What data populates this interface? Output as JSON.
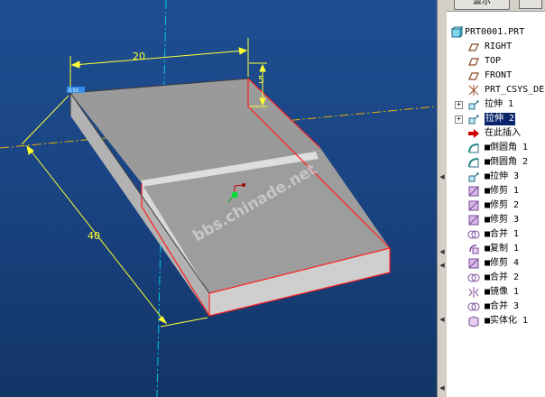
{
  "panel": {
    "show_button_label": "显示"
  },
  "model_tree": {
    "root": "PRT0001.PRT",
    "items": [
      {
        "label": "RIGHT",
        "icon": "datum-plane-icon",
        "expandable": false,
        "selected": false
      },
      {
        "label": "TOP",
        "icon": "datum-plane-icon",
        "expandable": false,
        "selected": false
      },
      {
        "label": "FRONT",
        "icon": "datum-plane-icon",
        "expandable": false,
        "selected": false
      },
      {
        "label": "PRT_CSYS_DE",
        "icon": "coordinate-system-icon",
        "expandable": false,
        "selected": false
      },
      {
        "label": "拉伸 1",
        "icon": "extrude-icon",
        "expandable": true,
        "selected": false
      },
      {
        "label": "拉伸 2",
        "icon": "extrude-icon",
        "expandable": true,
        "selected": true
      },
      {
        "label": "在此插入",
        "icon": "insert-here-arrow-icon",
        "expandable": false,
        "selected": false
      },
      {
        "label": "■倒圆角 1",
        "icon": "round-icon",
        "expandable": false,
        "selected": false
      },
      {
        "label": "■倒圆角 2",
        "icon": "round-icon",
        "expandable": false,
        "selected": false
      },
      {
        "label": "■拉伸 3",
        "icon": "extrude-icon",
        "expandable": false,
        "selected": false
      },
      {
        "label": "■修剪 1",
        "icon": "trim-icon",
        "expandable": false,
        "selected": false
      },
      {
        "label": "■修剪 2",
        "icon": "trim-icon",
        "expandable": false,
        "selected": false
      },
      {
        "label": "■修剪 3",
        "icon": "trim-icon",
        "expandable": false,
        "selected": false
      },
      {
        "label": "■合并 1",
        "icon": "merge-icon",
        "expandable": false,
        "selected": false
      },
      {
        "label": "■复制 1",
        "icon": "copy-icon",
        "expandable": false,
        "selected": false
      },
      {
        "label": "■修剪 4",
        "icon": "trim-icon",
        "expandable": false,
        "selected": false
      },
      {
        "label": "■合并 2",
        "icon": "merge-icon",
        "expandable": false,
        "selected": false
      },
      {
        "label": "■镜像 1",
        "icon": "mirror-icon",
        "expandable": false,
        "selected": false
      },
      {
        "label": "■合并 3",
        "icon": "merge-icon",
        "expandable": false,
        "selected": false
      },
      {
        "label": "■实体化 1",
        "icon": "solidify-icon",
        "expandable": false,
        "selected": false
      }
    ]
  },
  "viewport": {
    "dimensions": {
      "width": "20",
      "height": "5",
      "length": "40"
    },
    "small_label": "0.50",
    "watermark": "bbs.chinade.net"
  },
  "colors": {
    "background": "#1c4a8c",
    "dimension": "#ffff33",
    "edge_highlight": "#ff2020",
    "datum_axis": "#00c8e6",
    "selection": "#0a246a"
  }
}
